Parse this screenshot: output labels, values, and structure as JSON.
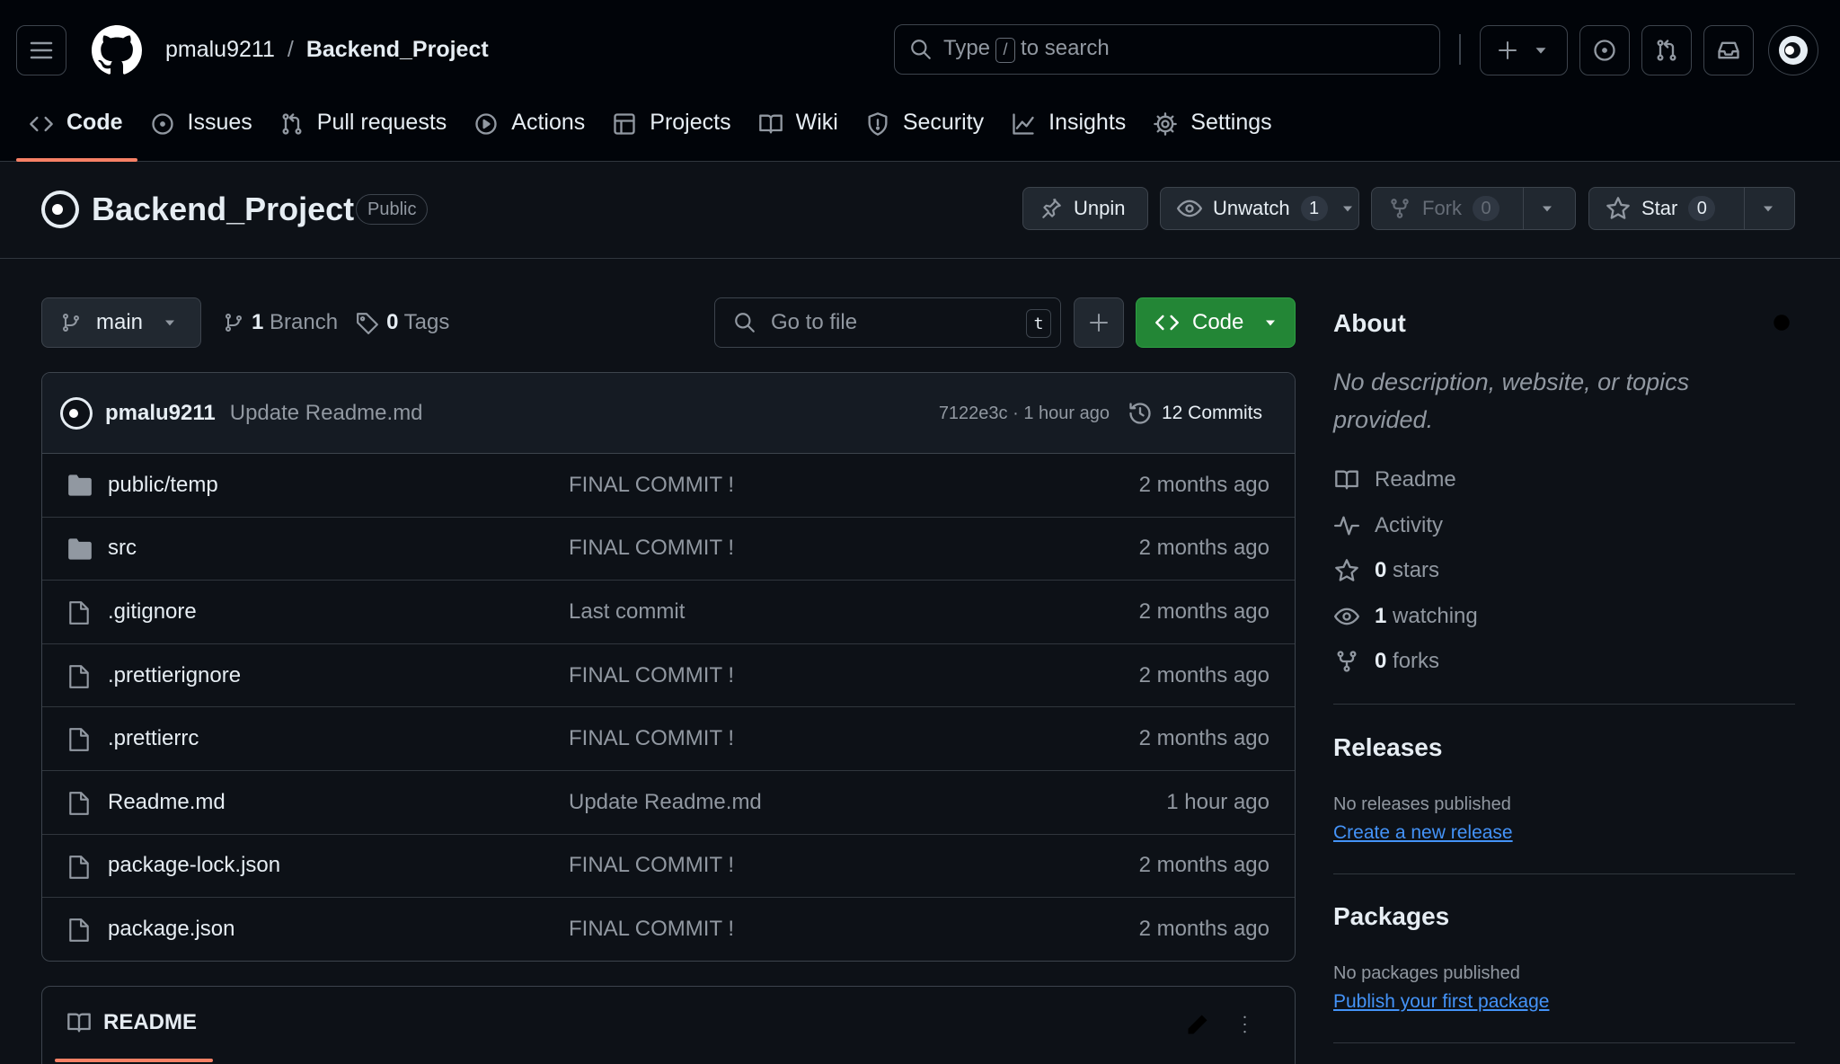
{
  "header": {
    "owner": "pmalu9211",
    "separator": "/",
    "repo": "Backend_Project",
    "search": {
      "prefix": "Type",
      "key": "/",
      "suffix": "to search"
    }
  },
  "nav": {
    "tabs": [
      {
        "label": "Code",
        "icon": "code-icon",
        "active": true
      },
      {
        "label": "Issues",
        "icon": "issue-opened-icon"
      },
      {
        "label": "Pull requests",
        "icon": "git-pull-request-icon"
      },
      {
        "label": "Actions",
        "icon": "play-icon"
      },
      {
        "label": "Projects",
        "icon": "table-icon"
      },
      {
        "label": "Wiki",
        "icon": "book-icon"
      },
      {
        "label": "Security",
        "icon": "shield-icon"
      },
      {
        "label": "Insights",
        "icon": "graph-icon"
      },
      {
        "label": "Settings",
        "icon": "gear-icon"
      }
    ]
  },
  "repo_header": {
    "name": "Backend_Project",
    "visibility": "Public",
    "unpin_label": "Unpin",
    "unwatch_label": "Unwatch",
    "watch_count": "1",
    "fork_label": "Fork",
    "fork_count": "0",
    "star_label": "Star",
    "star_count": "0"
  },
  "branch_bar": {
    "branch": "main",
    "branch_count": "1",
    "branch_label": "Branch",
    "tag_count": "0",
    "tag_label": "Tags",
    "goto_placeholder": "Go to file",
    "goto_key": "t",
    "code_label": "Code"
  },
  "latest_commit": {
    "author": "pmalu9211",
    "message": "Update Readme.md",
    "meta": "7122e3c · 1 hour ago",
    "commits_label": "12 Commits"
  },
  "files": [
    {
      "type": "folder",
      "name": "public/temp",
      "commit": "FINAL COMMIT !",
      "time": "2 months ago"
    },
    {
      "type": "folder",
      "name": "src",
      "commit": "FINAL COMMIT !",
      "time": "2 months ago"
    },
    {
      "type": "file",
      "name": ".gitignore",
      "commit": "Last commit",
      "time": "2 months ago"
    },
    {
      "type": "file",
      "name": ".prettierignore",
      "commit": "FINAL COMMIT !",
      "time": "2 months ago"
    },
    {
      "type": "file",
      "name": ".prettierrc",
      "commit": "FINAL COMMIT !",
      "time": "2 months ago"
    },
    {
      "type": "file",
      "name": "Readme.md",
      "commit": "Update Readme.md",
      "time": "1 hour ago"
    },
    {
      "type": "file",
      "name": "package-lock.json",
      "commit": "FINAL COMMIT !",
      "time": "2 months ago"
    },
    {
      "type": "file",
      "name": "package.json",
      "commit": "FINAL COMMIT !",
      "time": "2 months ago"
    }
  ],
  "readme": {
    "title": "README"
  },
  "about": {
    "title": "About",
    "description": "No description, website, or topics provided.",
    "readme_label": "Readme",
    "activity_label": "Activity",
    "stars_count": "0",
    "stars_label": "stars",
    "watching_count": "1",
    "watching_label": "watching",
    "forks_count": "0",
    "forks_label": "forks"
  },
  "releases": {
    "title": "Releases",
    "empty_text": "No releases published",
    "link": "Create a new release"
  },
  "packages": {
    "title": "Packages",
    "empty_text": "No packages published",
    "link": "Publish your first package"
  },
  "colors": {
    "accent_underline": "#f78166",
    "code_button": "#238636",
    "link": "#4493f8",
    "background": "#0d1117"
  }
}
